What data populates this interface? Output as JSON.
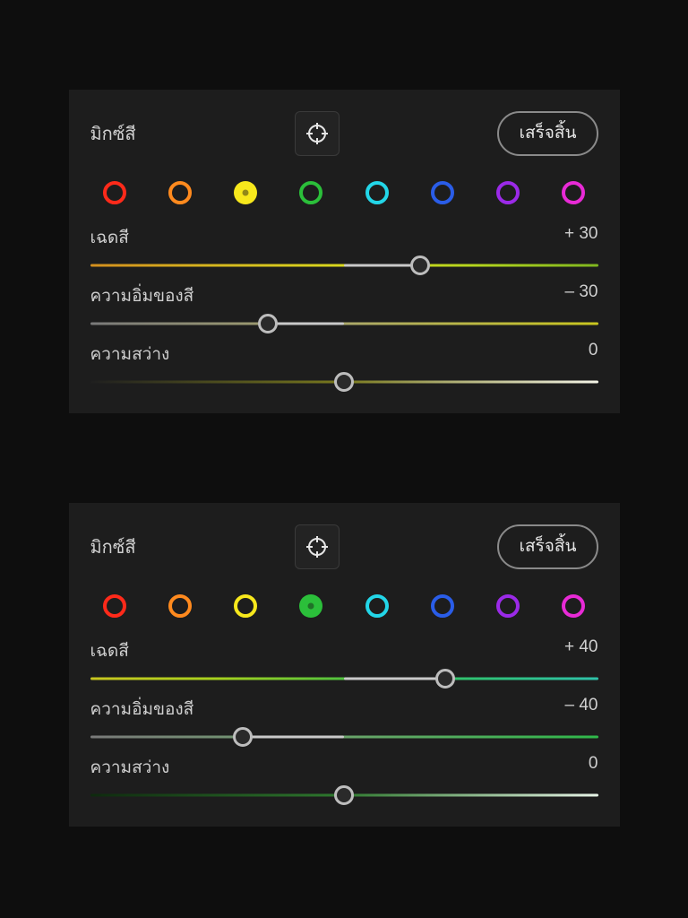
{
  "swatch_colors": [
    "#ff2a1a",
    "#ff8a1e",
    "#f7e81c",
    "#2bbf3a",
    "#23d6e8",
    "#2a5de8",
    "#9b2ae8",
    "#e82ad6"
  ],
  "panels": [
    {
      "title": "มิกซ์สี",
      "done_label": "เสร็จสิ้น",
      "selected_swatch": 2,
      "sliders": {
        "hue": {
          "label": "เฉดสี",
          "value": 30,
          "display": "+ 30",
          "gradient_class": "hue-yellow"
        },
        "sat": {
          "label": "ความอิ่มของสี",
          "value": -30,
          "display": "– 30",
          "gradient_class": "sat-yellow"
        },
        "lum": {
          "label": "ความสว่าง",
          "value": 0,
          "display": "0",
          "gradient_class": "lum-yellow"
        }
      }
    },
    {
      "title": "มิกซ์สี",
      "done_label": "เสร็จสิ้น",
      "selected_swatch": 3,
      "sliders": {
        "hue": {
          "label": "เฉดสี",
          "value": 40,
          "display": "+ 40",
          "gradient_class": "hue-green"
        },
        "sat": {
          "label": "ความอิ่มของสี",
          "value": -40,
          "display": "– 40",
          "gradient_class": "sat-green"
        },
        "lum": {
          "label": "ความสว่าง",
          "value": 0,
          "display": "0",
          "gradient_class": "lum-green"
        }
      }
    }
  ]
}
